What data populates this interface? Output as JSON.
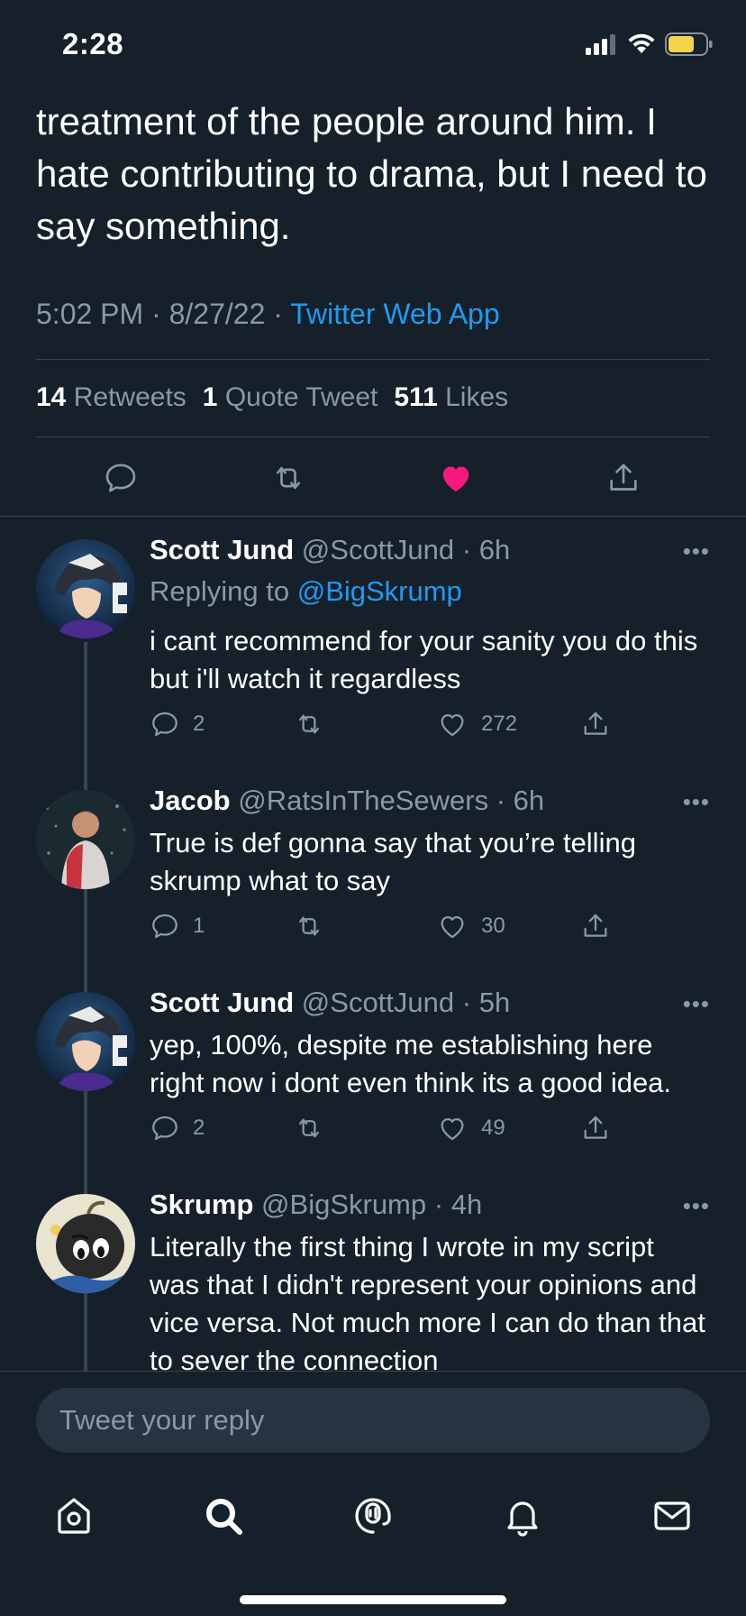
{
  "status_bar": {
    "time": "2:28",
    "icons": [
      "cellular-signal-icon",
      "wifi-icon",
      "battery-icon"
    ],
    "battery_color": "#f5d547"
  },
  "main_tweet": {
    "text": "treatment of the people around him. I hate contributing to drama, but I need to say something.",
    "time": "5:02 PM",
    "date": "8/27/22",
    "source": "Twitter Web App",
    "stats": {
      "retweets_count": "14",
      "retweets_label": "Retweets",
      "quotes_count": "1",
      "quotes_label": "Quote Tweet",
      "likes_count": "511",
      "likes_label": "Likes"
    },
    "actions": [
      "reply-icon",
      "retweet-icon",
      "like-icon",
      "share-icon"
    ],
    "liked": true,
    "like_color": "#f91880"
  },
  "replies": [
    {
      "name": "Scott Jund",
      "handle": "@ScottJund",
      "time": "6h",
      "replying_prefix": "Replying to",
      "replying_to": "@BigSkrump",
      "text": "i cant recommend for your sanity you do this but i'll watch it regardless",
      "reply_count": "2",
      "like_count": "272"
    },
    {
      "name": "Jacob",
      "handle": "@RatsInTheSewers",
      "time": "6h",
      "text": "True is def gonna say that you’re telling skrump what to say",
      "reply_count": "1",
      "like_count": "30"
    },
    {
      "name": "Scott Jund",
      "handle": "@ScottJund",
      "time": "5h",
      "text": "yep, 100%, despite me establishing here right now i dont even think its a good idea.",
      "reply_count": "2",
      "like_count": "49"
    },
    {
      "name": "Skrump",
      "handle": "@BigSkrump",
      "time": "4h",
      "text": "Literally the first thing I wrote in my script was that I didn't represent your opinions and vice versa. Not much more I can do than that to sever the connection"
    }
  ],
  "compose": {
    "placeholder": "Tweet your reply"
  },
  "tabbar": [
    "home-icon",
    "search-icon",
    "spaces-icon",
    "notifications-icon",
    "messages-icon"
  ],
  "colors": {
    "background": "#15202b",
    "accent": "#1d9bf0",
    "muted": "#8b98a5",
    "divider": "#38444d"
  }
}
